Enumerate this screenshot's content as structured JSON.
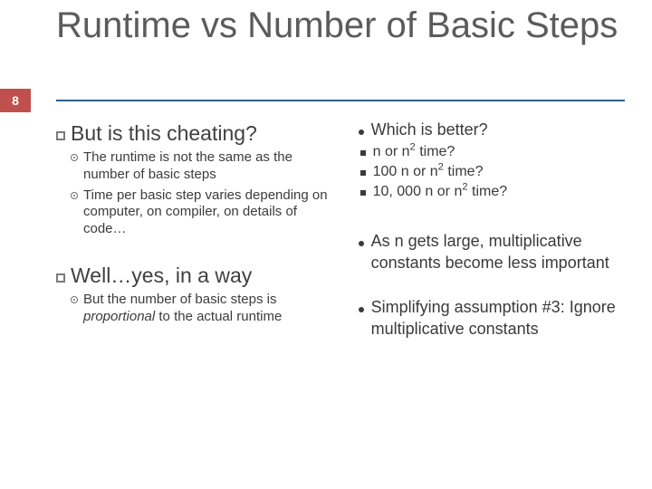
{
  "page_number": "8",
  "title": "Runtime vs Number of Basic Steps",
  "left": {
    "h1": "But is this cheating?",
    "b1a": "The runtime is not the same as the number of basic steps",
    "b1b": "Time per basic step varies depending on computer, on compiler, on details of code…",
    "h2": "Well…yes, in a way",
    "b2a_pre": "But the number of basic steps is ",
    "b2a_em": "proportional",
    "b2a_post": " to the actual runtime"
  },
  "right": {
    "q": "Which is better?",
    "opt1_a": "n or n",
    "opt1_b": " time?",
    "opt2_a": "100 n or n",
    "opt2_b": " time?",
    "opt3_a": "10, 000 n or n",
    "opt3_b": " time?",
    "note": "As n gets large, multiplicative constants become less important",
    "simp": "Simplifying assumption #3: Ignore multiplicative constants"
  }
}
